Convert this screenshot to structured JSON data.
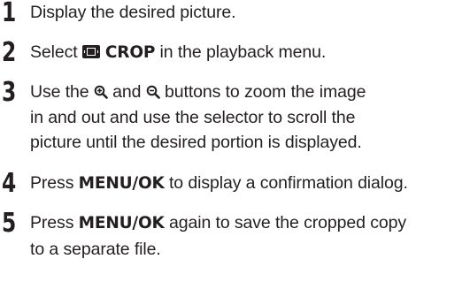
{
  "steps": [
    {
      "number": "1",
      "text": "Display the desired picture."
    },
    {
      "number": "2",
      "pre": "Select ",
      "icon": "crop-icon",
      "keyword": "CROP",
      "post": " in the playback menu."
    },
    {
      "number": "3",
      "lines": [
        {
          "pre": "Use the ",
          "icon1": "zoom-in-icon",
          "mid": " and ",
          "icon2": "zoom-out-icon",
          "post": " buttons to zoom the image"
        },
        {
          "text": "in and out and use the selector to scroll the"
        },
        {
          "text": "picture until the desired portion is displayed."
        }
      ]
    },
    {
      "number": "4",
      "pre": "Press ",
      "keyword": "MENU/OK",
      "post": " to display a confirmation dialog."
    },
    {
      "number": "5",
      "lines": [
        {
          "pre": "Press ",
          "keyword": "MENU/OK",
          "post": " again to save the cropped copy"
        },
        {
          "text": "to a separate file."
        }
      ]
    }
  ],
  "colors": {
    "text": "#231f20",
    "background": "#ffffff"
  }
}
